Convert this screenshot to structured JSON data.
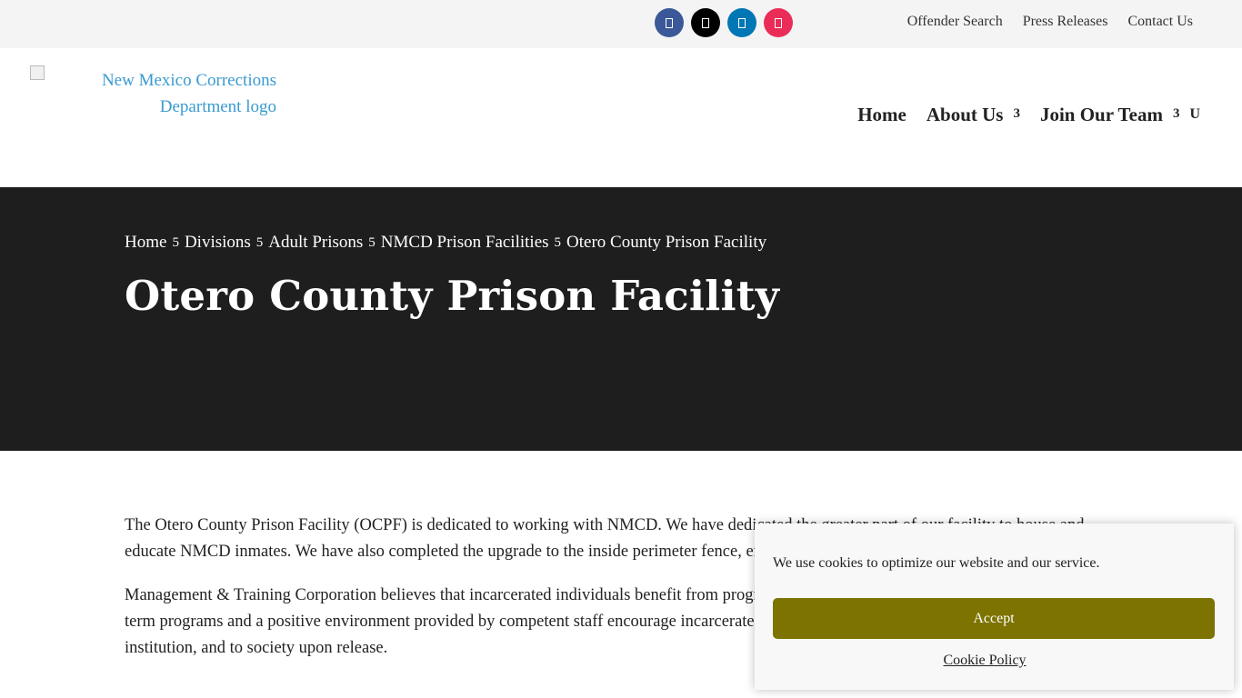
{
  "topbar": {
    "social": [
      {
        "name": "facebook-icon",
        "color": "#3b5998"
      },
      {
        "name": "x-icon",
        "color": "#000000"
      },
      {
        "name": "linkedin-icon",
        "color": "#0077b5"
      },
      {
        "name": "instagram-icon",
        "color": "#ea2c59"
      }
    ],
    "links": [
      "Offender Search",
      "Press Releases",
      "Contact Us"
    ]
  },
  "header": {
    "logo_alt": "New Mexico Corrections Department logo",
    "nav": [
      {
        "label": "Home",
        "caret": ""
      },
      {
        "label": "About Us",
        "caret": "3"
      },
      {
        "label": "Join Our Team",
        "caret": "3"
      }
    ],
    "search_glyph": "U"
  },
  "hero": {
    "breadcrumb": [
      "Home",
      "Divisions",
      "Adult Prisons",
      "NMCD Prison Facilities",
      "Otero County Prison Facility"
    ],
    "separator": "5",
    "title": "Otero County Prison Facility"
  },
  "content": {
    "paragraphs": [
      "The Otero County Prison Facility (OCPF) is dedicated to working with NMCD. We have dedicated the greater part of our facility to house and educate NMCD inmates. We have also completed the upgrade to the inside perimeter fence, enabling inmates to use the Sweat Lodge.",
      "Management & Training Corporation believes that incarcerated individuals benefit from programs which prepare them for release. Quality short-term programs and a positive environment provided by competent staff encourage incarcerated persons to appropriately adjust to the correctional institution, and to society upon release."
    ]
  },
  "cookie": {
    "message": "We use cookies to optimize our website and our service.",
    "accept_label": "Accept",
    "policy_label": "Cookie Policy",
    "accept_color": "#7d7300"
  }
}
